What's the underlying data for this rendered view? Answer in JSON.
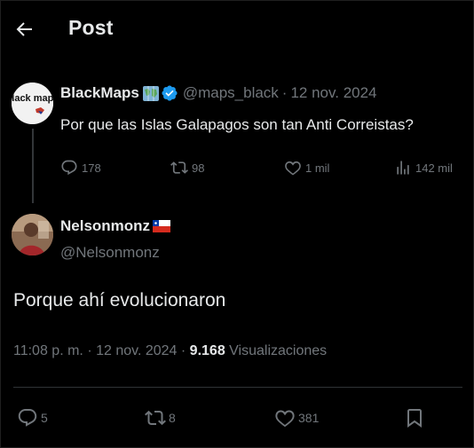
{
  "header": {
    "title": "Post"
  },
  "parent_post": {
    "author_name": "BlackMaps",
    "avatar_text": "black maps",
    "handle": "@maps_black",
    "date": "12 nov. 2024",
    "text": "Por que las Islas Galapagos son tan Anti Correistas?",
    "stats": {
      "replies": "178",
      "reposts": "98",
      "likes": "1 mil",
      "views": "142 mil"
    }
  },
  "reply_post": {
    "author_name": "Nelsonmonz",
    "handle": "@Nelsonmonz",
    "text": "Porque ahí evolucionaron",
    "time": "11:08 p. m.",
    "date": "12 nov. 2024",
    "views_count": "9.168",
    "views_label": "Visualizaciones",
    "stats": {
      "replies": "5",
      "reposts": "8",
      "likes": "381"
    }
  },
  "colors": {
    "background": "#000000",
    "text": "#e7e9ea",
    "muted": "#71767b",
    "verified": "#1d9bf0",
    "divider": "#2f3336"
  }
}
